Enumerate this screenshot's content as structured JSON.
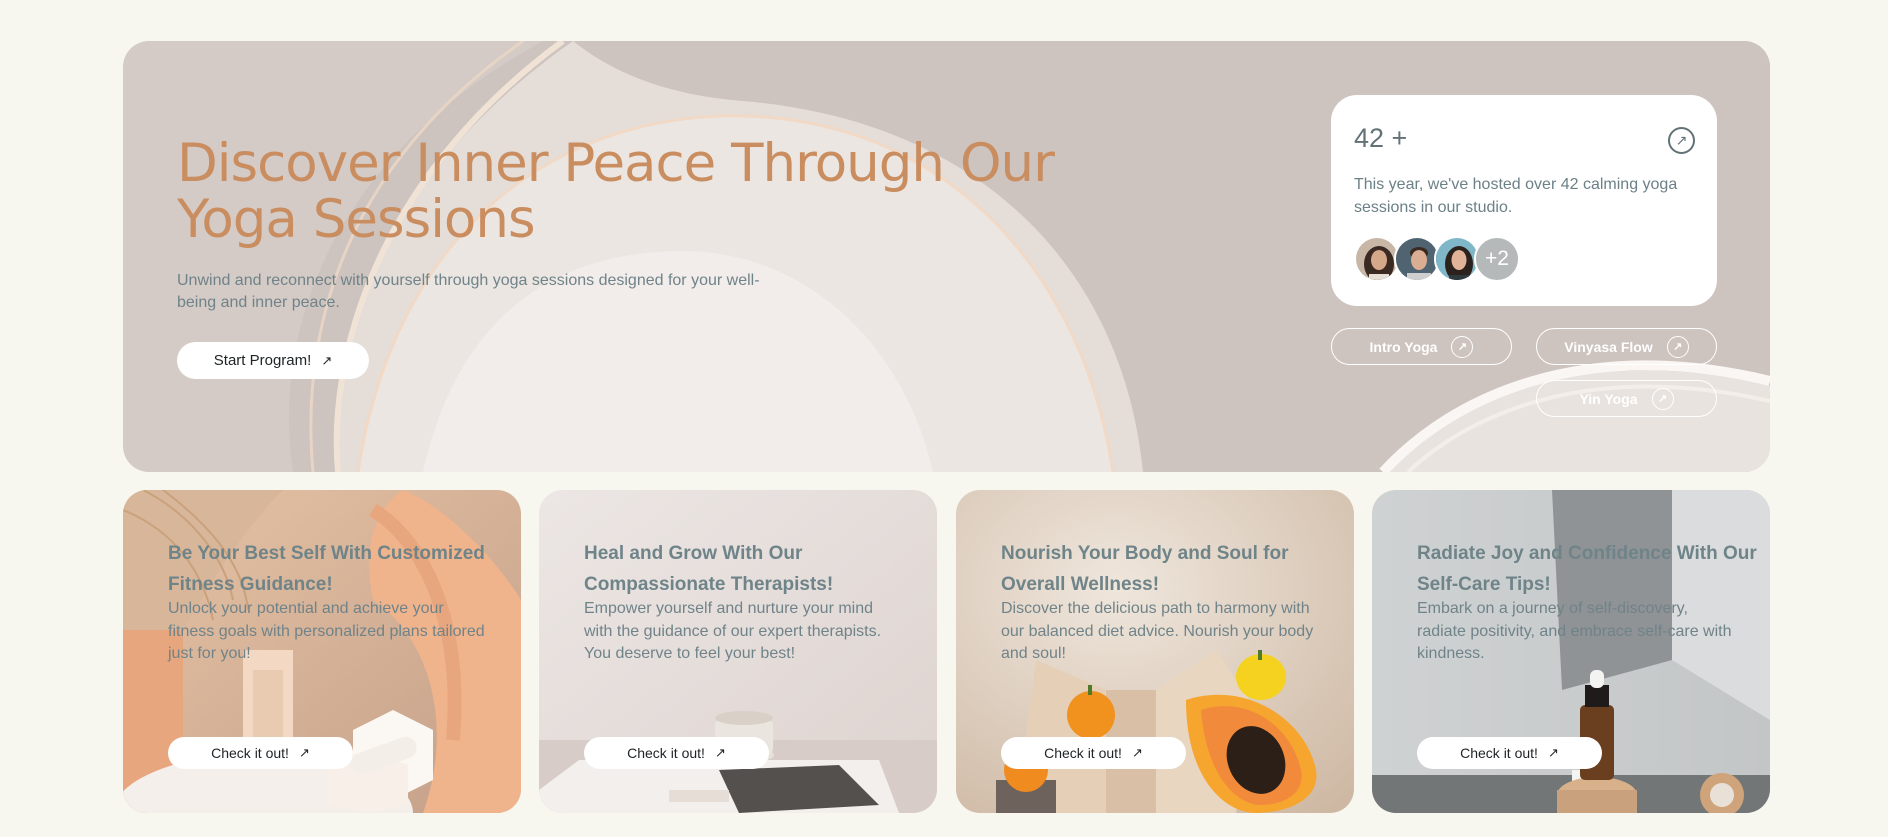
{
  "hero": {
    "title": "Discover Inner Peace Through Our Yoga Sessions",
    "subtitle": "Unwind and reconnect with yourself through yoga sessions designed for your well-being and inner peace.",
    "cta_label": "Start Program!",
    "cta_icon": "arrow-up-right-icon"
  },
  "stat_card": {
    "value": "42 +",
    "description": "This year, we've hosted over 42 calming yoga sessions in our studio.",
    "avatar_extra": "+2",
    "link_icon": "arrow-up-right-circle-icon"
  },
  "tags": [
    {
      "label": "Intro Yoga"
    },
    {
      "label": "Vinyasa Flow"
    },
    {
      "label": "Yin Yoga"
    }
  ],
  "cards": [
    {
      "title": "Be Your Best Self With Customized Fitness Guidance!",
      "description": "Unlock your potential and achieve your fitness goals with personalized plans tailored just for you!",
      "button": "Check it out!"
    },
    {
      "title": "Heal and Grow With Our Compassionate Therapists!",
      "description": "Empower yourself and nurture your mind with the guidance of our expert therapists. You deserve to feel your best!",
      "button": "Check it out!"
    },
    {
      "title": "Nourish Your Body and Soul for Overall Wellness!",
      "description": "Discover the delicious path to harmony with our balanced diet advice. Nourish your body and soul!",
      "button": "Check it out!"
    },
    {
      "title": "Radiate Joy and Confidence With Our Self-Care Tips!",
      "description": "Embark on a journey of self-discovery, radiate positivity, and embrace self-care with kindness.",
      "button": "Check it out!"
    }
  ],
  "colors": {
    "page_bg": "#f7f6ef",
    "hero_bg": "#d4cbc7",
    "accent": "#c98d5f",
    "text_muted": "#6f8389"
  }
}
